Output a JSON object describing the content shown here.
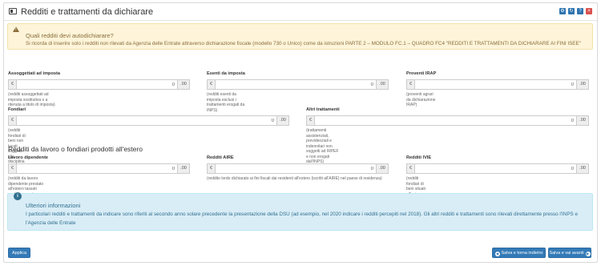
{
  "header": {
    "title": "Redditi e trattamenti da dichiarare",
    "buttons": [
      {
        "name": "gear",
        "icon": "gear-icon",
        "glyph": "⚙",
        "color": "#2f74b0"
      },
      {
        "name": "refresh",
        "icon": "refresh-icon",
        "glyph": "↻",
        "color": "#2f74b0"
      },
      {
        "name": "help",
        "icon": "question-icon",
        "glyph": "?",
        "color": "#2f74b0"
      },
      {
        "name": "close",
        "icon": "close-icon",
        "glyph": "×",
        "color": "#d9534f"
      }
    ]
  },
  "warning": {
    "icon": "warning-icon",
    "title": "Quali redditi devi autodichiarare?",
    "text": "Si ricorda di inserire solo i redditi non rilevati da Agenzia delle Entrate attraverso dichiarazione fiscale (modello 730 o Unico) come da istruzioni PARTE 2 – MODULO FC.1 – QUADRO FC4 \"REDDITI E TRATTAMENTI DA DICHIARARE AI FINI ISEE\""
  },
  "currency_symbol": "€",
  "decimals": ".00",
  "fields": {
    "assoggettati": {
      "label": "Assoggettati ad imposta",
      "value": "0",
      "help": "(redditi assoggettati ad imposta sostitutiva o a ritenuta a titolo di imposta)"
    },
    "esenti": {
      "label": "Esenti da imposta",
      "value": "0",
      "help": "(redditi esenti da imposta esclusi i trattamenti erogati da INPS)"
    },
    "irap": {
      "label": "Proventi IRAP",
      "value": "0",
      "help": "(proventi agrari da dichiarazione IRAP)"
    },
    "fondiari": {
      "label": "Fondiari",
      "value": "0",
      "help": "(redditi fondiari di beni non locati soggetti alla disciplina dell'IMU)"
    },
    "altri": {
      "label": "Altri trattamenti",
      "value": "0",
      "help": "(trattamenti assistenziali, previdenziali e indennitari non soggetti ad IRPEF e non erogati dall'INPS)"
    },
    "lavoro": {
      "label": "Lavoro dipendente",
      "value": "0",
      "help": "(redditi da lavoro dipendente prestato all'estero tassati esclusivamente all'estero)"
    },
    "aire": {
      "label": "Redditi AIRE",
      "value": "0",
      "help": "(reddito lordo dichiarato ai fini fiscali dai residenti all'estero (iscritti all'AIRE) nel paese di residenza)"
    },
    "ivie": {
      "label": "Redditi IVIE",
      "value": "0",
      "help": "(redditi fondiari di beni situati all'estero non soggetti alla disciplina dell'IVIE)"
    }
  },
  "section_estero": {
    "title": "Redditi da lavoro o fondiari prodotti all'estero"
  },
  "info": {
    "icon": "info-icon",
    "title": "Ulteriori informazioni",
    "text": "I particolari redditi e trattamenti da indicare sono riferiti al secondo anno solare precedente la presentazione della DSU (ad esempio, nel 2020 indicare i redditi percepiti nel 2018). Gli altri redditi e trattamenti sono rilevati direttamente presso l'INPS e l'Agenzia delle Entrate"
  },
  "footer": {
    "apply_label": "Applica",
    "back_label": "Salva e torna indietro",
    "next_label": "Salva e vai avanti"
  }
}
